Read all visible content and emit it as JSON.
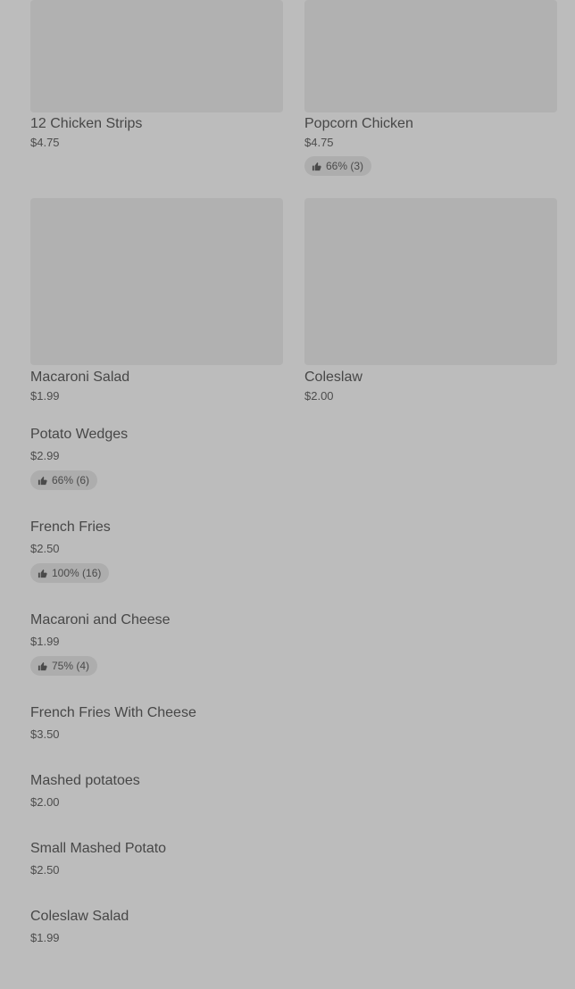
{
  "grid_items": [
    {
      "name": "12 Chicken Strips",
      "price": "$4.75",
      "rating": ""
    },
    {
      "name": "Popcorn Chicken",
      "price": "$4.75",
      "rating": "66% (3)"
    },
    {
      "name": "Macaroni Salad",
      "price": "$1.99",
      "rating": ""
    },
    {
      "name": "Coleslaw",
      "price": "$2.00",
      "rating": ""
    }
  ],
  "list_items": [
    {
      "name": "Potato Wedges",
      "price": "$2.99",
      "rating": "66% (6)"
    },
    {
      "name": "French Fries",
      "price": "$2.50",
      "rating": "100% (16)"
    },
    {
      "name": "Macaroni and Cheese",
      "price": "$1.99",
      "rating": "75% (4)"
    },
    {
      "name": "French Fries With Cheese",
      "price": "$3.50",
      "rating": ""
    },
    {
      "name": "Mashed potatoes",
      "price": "$2.00",
      "rating": ""
    },
    {
      "name": "Small Mashed Potato",
      "price": "$2.50",
      "rating": ""
    },
    {
      "name": "Coleslaw Salad",
      "price": "$1.99",
      "rating": ""
    }
  ],
  "icons": {
    "rating": "thumbs-up-icon"
  },
  "colors": {
    "overlay_background": "#bcbcbc",
    "image_placeholder": "#b1b1b1",
    "rating_badge": "#adadad",
    "text": "#474747"
  }
}
